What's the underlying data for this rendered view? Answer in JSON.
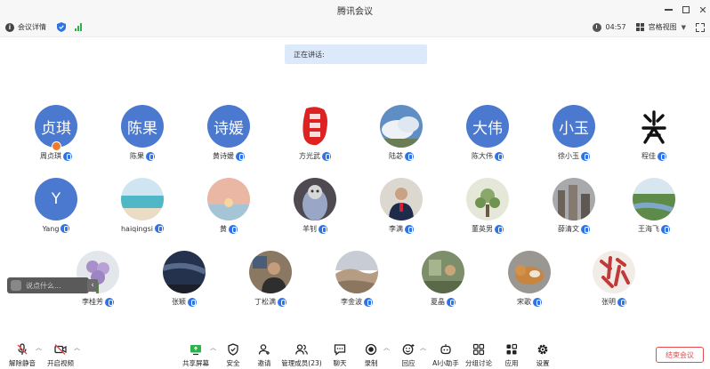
{
  "window": {
    "title": "腾讯会议"
  },
  "infobar": {
    "details_label": "会议详情",
    "time": "04:57",
    "view_label": "宫格视图"
  },
  "speaking_label": "正在讲话:",
  "participants": [
    {
      "name": "周贞琪",
      "avatar_text": "贞琪",
      "kind": "blue",
      "host": true
    },
    {
      "name": "陈果",
      "avatar_text": "陈果",
      "kind": "blue"
    },
    {
      "name": "黄诗媛",
      "avatar_text": "诗媛",
      "kind": "blue"
    },
    {
      "name": "方光武",
      "avatar_text": "",
      "kind": "seal"
    },
    {
      "name": "陆苾",
      "avatar_text": "",
      "kind": "sky"
    },
    {
      "name": "陈大伟",
      "avatar_text": "大伟",
      "kind": "blue"
    },
    {
      "name": "徐小玉",
      "avatar_text": "小玉",
      "kind": "blue"
    },
    {
      "name": "程佳",
      "avatar_text": "",
      "kind": "calligraphy"
    },
    {
      "name": "Yang",
      "avatar_text": "Y",
      "kind": "blue"
    },
    {
      "name": "haiqingsi",
      "avatar_text": "",
      "kind": "sea"
    },
    {
      "name": "黄",
      "avatar_text": "",
      "kind": "sunset"
    },
    {
      "name": "羊钊",
      "avatar_text": "",
      "kind": "cat"
    },
    {
      "name": "李满",
      "avatar_text": "",
      "kind": "person"
    },
    {
      "name": "董英男",
      "avatar_text": "",
      "kind": "plant"
    },
    {
      "name": "薛清文",
      "avatar_text": "",
      "kind": "city"
    },
    {
      "name": "王海飞",
      "avatar_text": "",
      "kind": "river"
    },
    {
      "name": "李桂芳",
      "avatar_text": "",
      "kind": "flower"
    },
    {
      "name": "张颖",
      "avatar_text": "",
      "kind": "night"
    },
    {
      "name": "丁松满",
      "avatar_text": "",
      "kind": "office"
    },
    {
      "name": "李金波",
      "avatar_text": "",
      "kind": "desert"
    },
    {
      "name": "夏晶",
      "avatar_text": "",
      "kind": "room"
    },
    {
      "name": "宋歌",
      "avatar_text": "",
      "kind": "dog"
    },
    {
      "name": "张明",
      "avatar_text": "",
      "kind": "art"
    }
  ],
  "chat": {
    "placeholder": "说点什么...",
    "arrow": "‹"
  },
  "toolbar": {
    "unmute": "解除静音",
    "start_video": "开启视频",
    "share": "共享屏幕",
    "security": "安全",
    "invite": "邀请",
    "members": "管理成员(23)",
    "chat": "聊天",
    "record": "录制",
    "reactions": "回应",
    "ai": "AI小助手",
    "breakout": "分组讨论",
    "apps": "应用",
    "settings": "设置",
    "end": "结束会议"
  },
  "colors": {
    "avatar_blue": "#4a79cf",
    "mic_blue": "#2f73e6",
    "end_red": "#e64c4c",
    "speaking_bg": "#dce9fb"
  }
}
